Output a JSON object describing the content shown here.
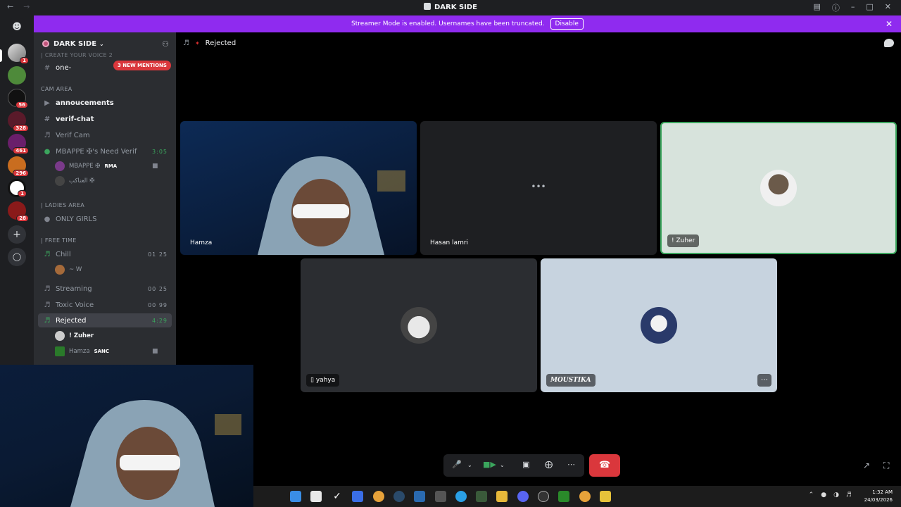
{
  "window": {
    "title": "DARK SIDE"
  },
  "banner": {
    "text": "Streamer Mode is enabled. Usernames have been truncated.",
    "button": "Disable"
  },
  "guild_badges": [
    "1",
    "56",
    "328",
    "461",
    "296",
    "1",
    "28"
  ],
  "server": {
    "name": "DARK SIDE",
    "mentions": "3 NEW MENTIONS"
  },
  "sidebar": {
    "partial_category": "| CREATE YOUR VOICE 2",
    "partial_channel": "one-",
    "cam_area": "CAM AREA",
    "announcements": "annoucements",
    "verif_chat": "verif-chat",
    "verif_cam": "Verif Cam",
    "need_verif": "MBAPPE ✠'s Need Verif",
    "need_verif_time": "3:05",
    "user_mbappe": "MBAPPE ✠",
    "user_mbappe_tag": "RMA",
    "user_arabic": "العناكب ✠",
    "ladies_area": "| LADIES AREA",
    "only_girls": "ONLY GIRLS",
    "free_time": "| FREE TIME",
    "chill": "Chill",
    "chill_count": "01 25",
    "user_w": "~ W",
    "streaming": "Streaming",
    "streaming_count": "00 25",
    "toxic_voice": "Toxic Voice",
    "toxic_count": "00 99",
    "rejected": "Rejected",
    "rejected_time": "4:29",
    "user_zuher": "! Zuher",
    "user_hamza": "Hamza",
    "user_hamza_tag": "SANC"
  },
  "channel": {
    "name": "Rejected"
  },
  "tiles": [
    {
      "name": "Hamza"
    },
    {
      "name": "Hasan lamri",
      "status": "•••"
    },
    {
      "name": "! Zuher"
    },
    {
      "name": "yahya"
    },
    {
      "name": "MOUSTIKA",
      "more": "⋯"
    }
  ],
  "clock": {
    "time": "1:32 AM",
    "date": "24/03/2026"
  },
  "colors": {
    "banner": "#8f2bef",
    "leave": "#da373c",
    "speaking_border": "#3ba55d"
  }
}
